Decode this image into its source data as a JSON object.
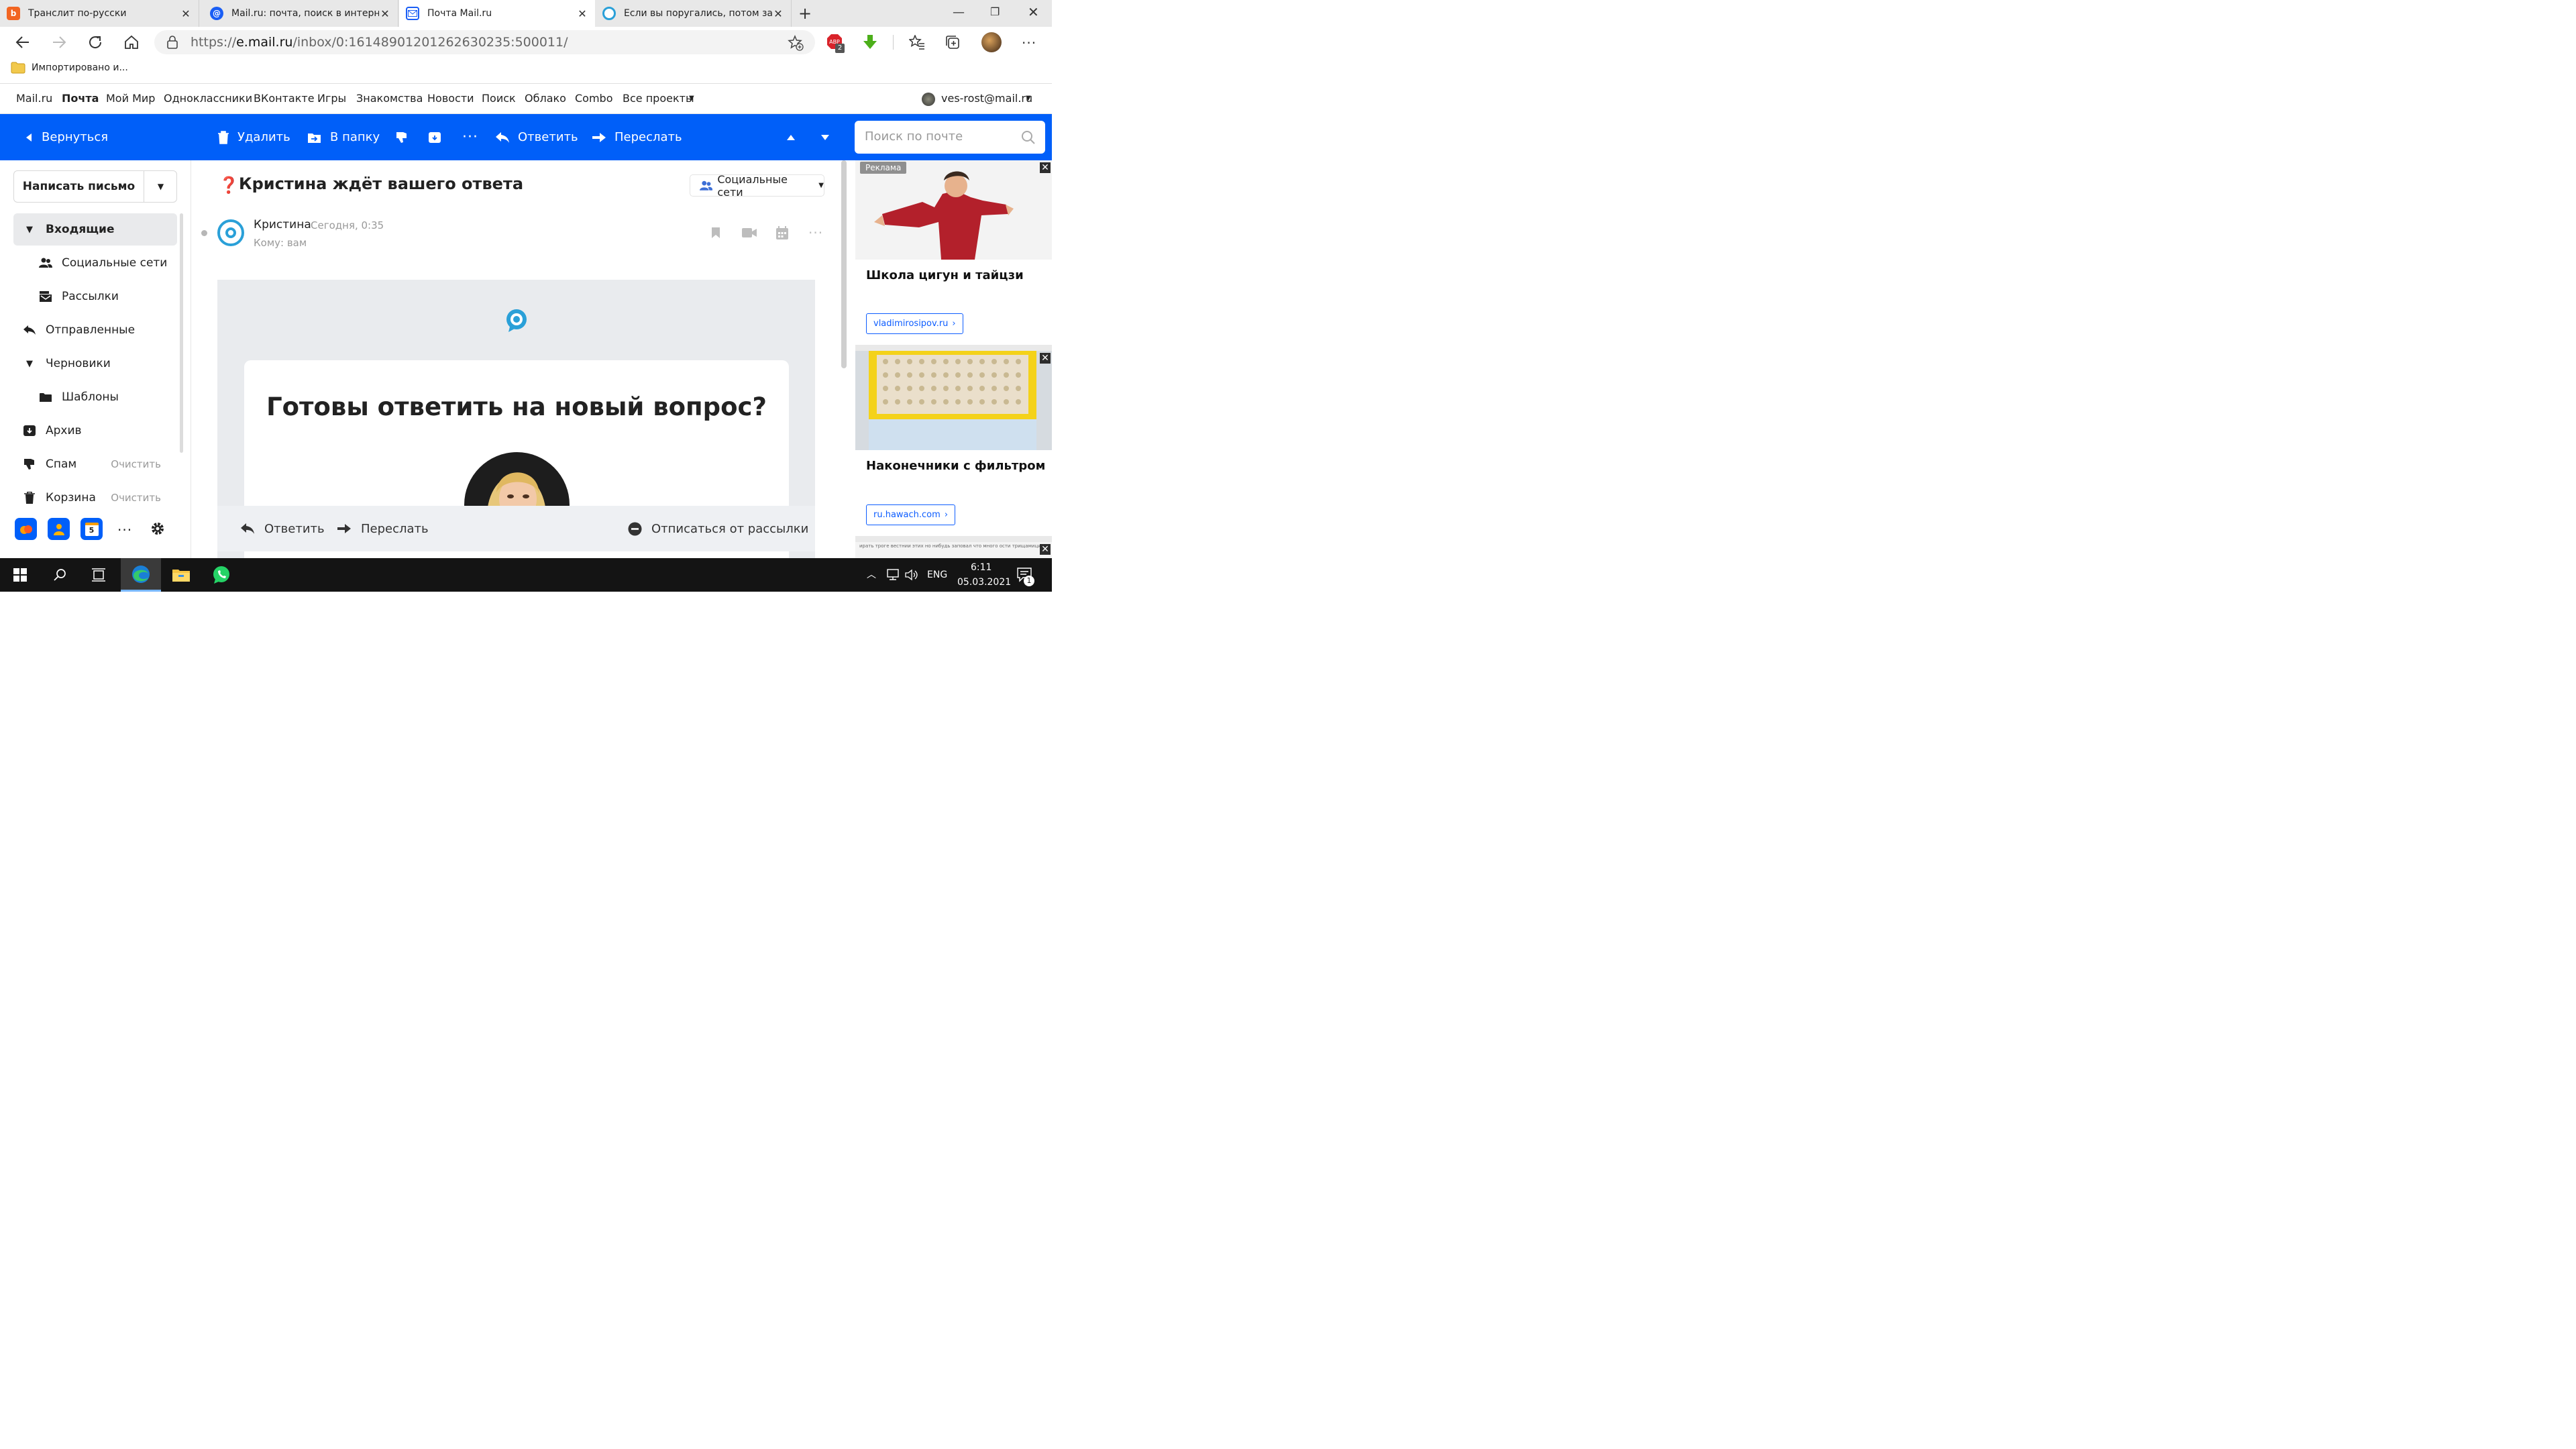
{
  "browser": {
    "tabs": [
      {
        "title": "Транслит по-русски",
        "icon": "translit-favicon"
      },
      {
        "title": "Mail.ru: почта, поиск в интерне",
        "icon": "mailru-favicon"
      },
      {
        "title": "Почта Mail.ru",
        "icon": "mail-favicon",
        "active": true
      },
      {
        "title": "Если вы поругались, потом заб",
        "icon": "otvety-favicon"
      }
    ],
    "url_scheme": "https://",
    "url_host": "e.mail.ru",
    "url_path": "/inbox/0:16148901201262630235:500011/",
    "adblock_badge": "2",
    "bookmark": "Импортировано и..."
  },
  "portal": {
    "links": [
      "Mail.ru",
      "Почта",
      "Мой Мир",
      "Одноклассники",
      "ВКонтакте",
      "Игры",
      "Знакомства",
      "Новости",
      "Поиск",
      "Облако",
      "Combo",
      "Все проекты"
    ],
    "account": "ves-rost@mail.ru"
  },
  "toolbar": {
    "back": "Вернуться",
    "delete": "Удалить",
    "move": "В папку",
    "reply": "Ответить",
    "forward": "Переслать",
    "search_placeholder": "Поиск по почте",
    "accent_color": "#005ff9"
  },
  "sidebar": {
    "compose": "Написать письмо",
    "folders": [
      {
        "label": "Входящие",
        "icon": "caret-down-icon",
        "selected": true
      },
      {
        "label": "Социальные сети",
        "icon": "people-icon"
      },
      {
        "label": "Рассылки",
        "icon": "newsletter-icon"
      },
      {
        "label": "Отправленные",
        "icon": "sent-icon"
      },
      {
        "label": "Черновики",
        "icon": "caret-down-icon"
      },
      {
        "label": "Шаблоны",
        "icon": "folder-icon"
      },
      {
        "label": "Архив",
        "icon": "archive-icon"
      },
      {
        "label": "Спам",
        "icon": "spam-icon",
        "action": "Очистить"
      },
      {
        "label": "Корзина",
        "icon": "trash-icon",
        "action": "Очистить"
      }
    ],
    "calendar_day": "5"
  },
  "message": {
    "subject": "Кристина ждёт вашего ответа",
    "category": "Социальные сети",
    "sender": "Кристина",
    "time": "Сегодня, 0:35",
    "to": "Кому: вам",
    "headline": "Готовы ответить на новый вопрос?"
  },
  "message_actions": {
    "reply": "Ответить",
    "forward": "Переслать",
    "unsubscribe": "Отписаться от рассылки"
  },
  "ads": {
    "label": "Реклама",
    "items": [
      {
        "title": "Школа цигун и тайцзи",
        "link": "vladimirosipov.ru"
      },
      {
        "title": "Наконечники с фильтром",
        "link": "ru.hawach.com"
      }
    ],
    "third_strip": "ирать троге вестнии этих но нибудь заповал что много ости трищамицию врет"
  },
  "taskbar": {
    "lang": "ENG",
    "time": "6:11",
    "date": "05.03.2021",
    "notifications": "1"
  }
}
